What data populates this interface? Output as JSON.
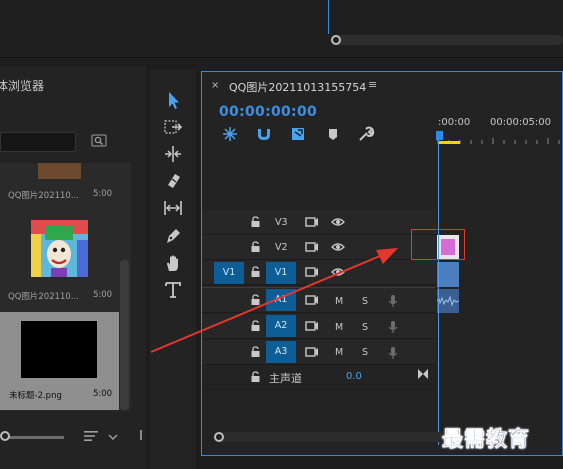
{
  "media_browser": {
    "title": "媒体浏览器",
    "items": [
      {
        "name": "QQ图片202110...",
        "duration": "5:00"
      },
      {
        "name": "QQ图片202110...",
        "duration": "5:00"
      },
      {
        "name": "未标题-2.png",
        "duration": "5:00"
      }
    ]
  },
  "timeline": {
    "sequence_title": "QQ图片20211013155754",
    "close_glyph": "×",
    "menu_glyph": "≡",
    "timecode": "00:00:00:00",
    "ruler_labels": [
      ":00:00",
      "00:00:05:00"
    ],
    "tracks": {
      "v3": "V3",
      "v2": "V2",
      "v1": "V1",
      "v1_source": "V1",
      "a1": "A1",
      "a2": "A2",
      "a3": "A3",
      "mute": "M",
      "solo": "S",
      "master_label": "主声道",
      "master_value": "0.0"
    }
  },
  "watermark": "最需教育",
  "colors": {
    "accent": "#2d8ceb",
    "track_target": "#0d5e96",
    "annotation_red": "#e6372f",
    "work_area": "#f5d300",
    "clip_video": "#d86bd6"
  }
}
